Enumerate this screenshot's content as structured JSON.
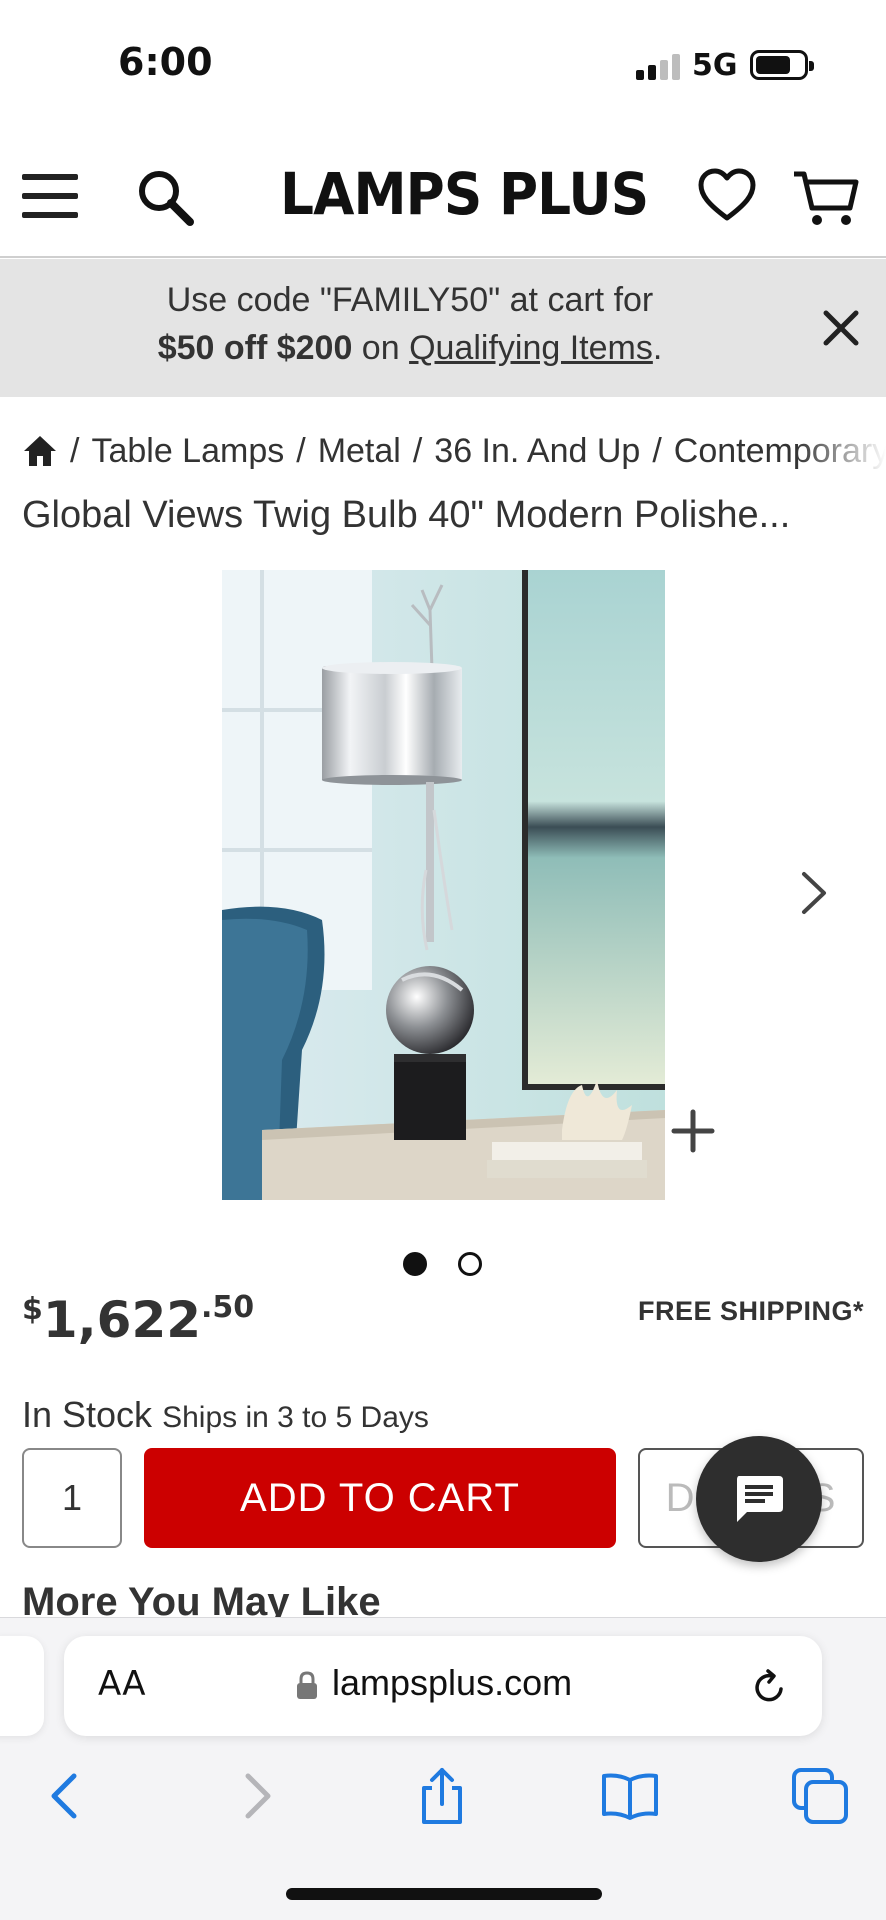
{
  "status_bar": {
    "time": "6:00",
    "network": "5G"
  },
  "header": {
    "logo": "LAMPS PLUS"
  },
  "promo": {
    "line1": "Use code \"FAMILY50\" at cart for",
    "line2_bold": "$50 off $200",
    "line2_mid": " on ",
    "line2_link": "Qualifying Items",
    "line2_end": "."
  },
  "breadcrumb": {
    "items": [
      "Table Lamps",
      "Metal",
      "36 In. And Up",
      "Contemporary"
    ]
  },
  "product": {
    "title": "Global Views Twig Bulb 40\" Modern Polishe...",
    "price_currency": "$",
    "price_main": "1,622",
    "price_cents": ".50",
    "free_shipping": "FREE SHIPPING*",
    "stock_status": "In Stock",
    "ships": "Ships in 3 to 5 Days",
    "quantity": "1",
    "add_to_cart_label": "ADD TO CART",
    "details_label": "DETAILS",
    "image_count": 2,
    "image_active_index": 0
  },
  "more_heading": "More You May Like",
  "browser": {
    "text_size": "AA",
    "url": "lampsplus.com"
  },
  "colors": {
    "brand_red": "#cc0000",
    "promo_bg": "#e4e4e4",
    "ios_blue": "#1f7ae0"
  }
}
